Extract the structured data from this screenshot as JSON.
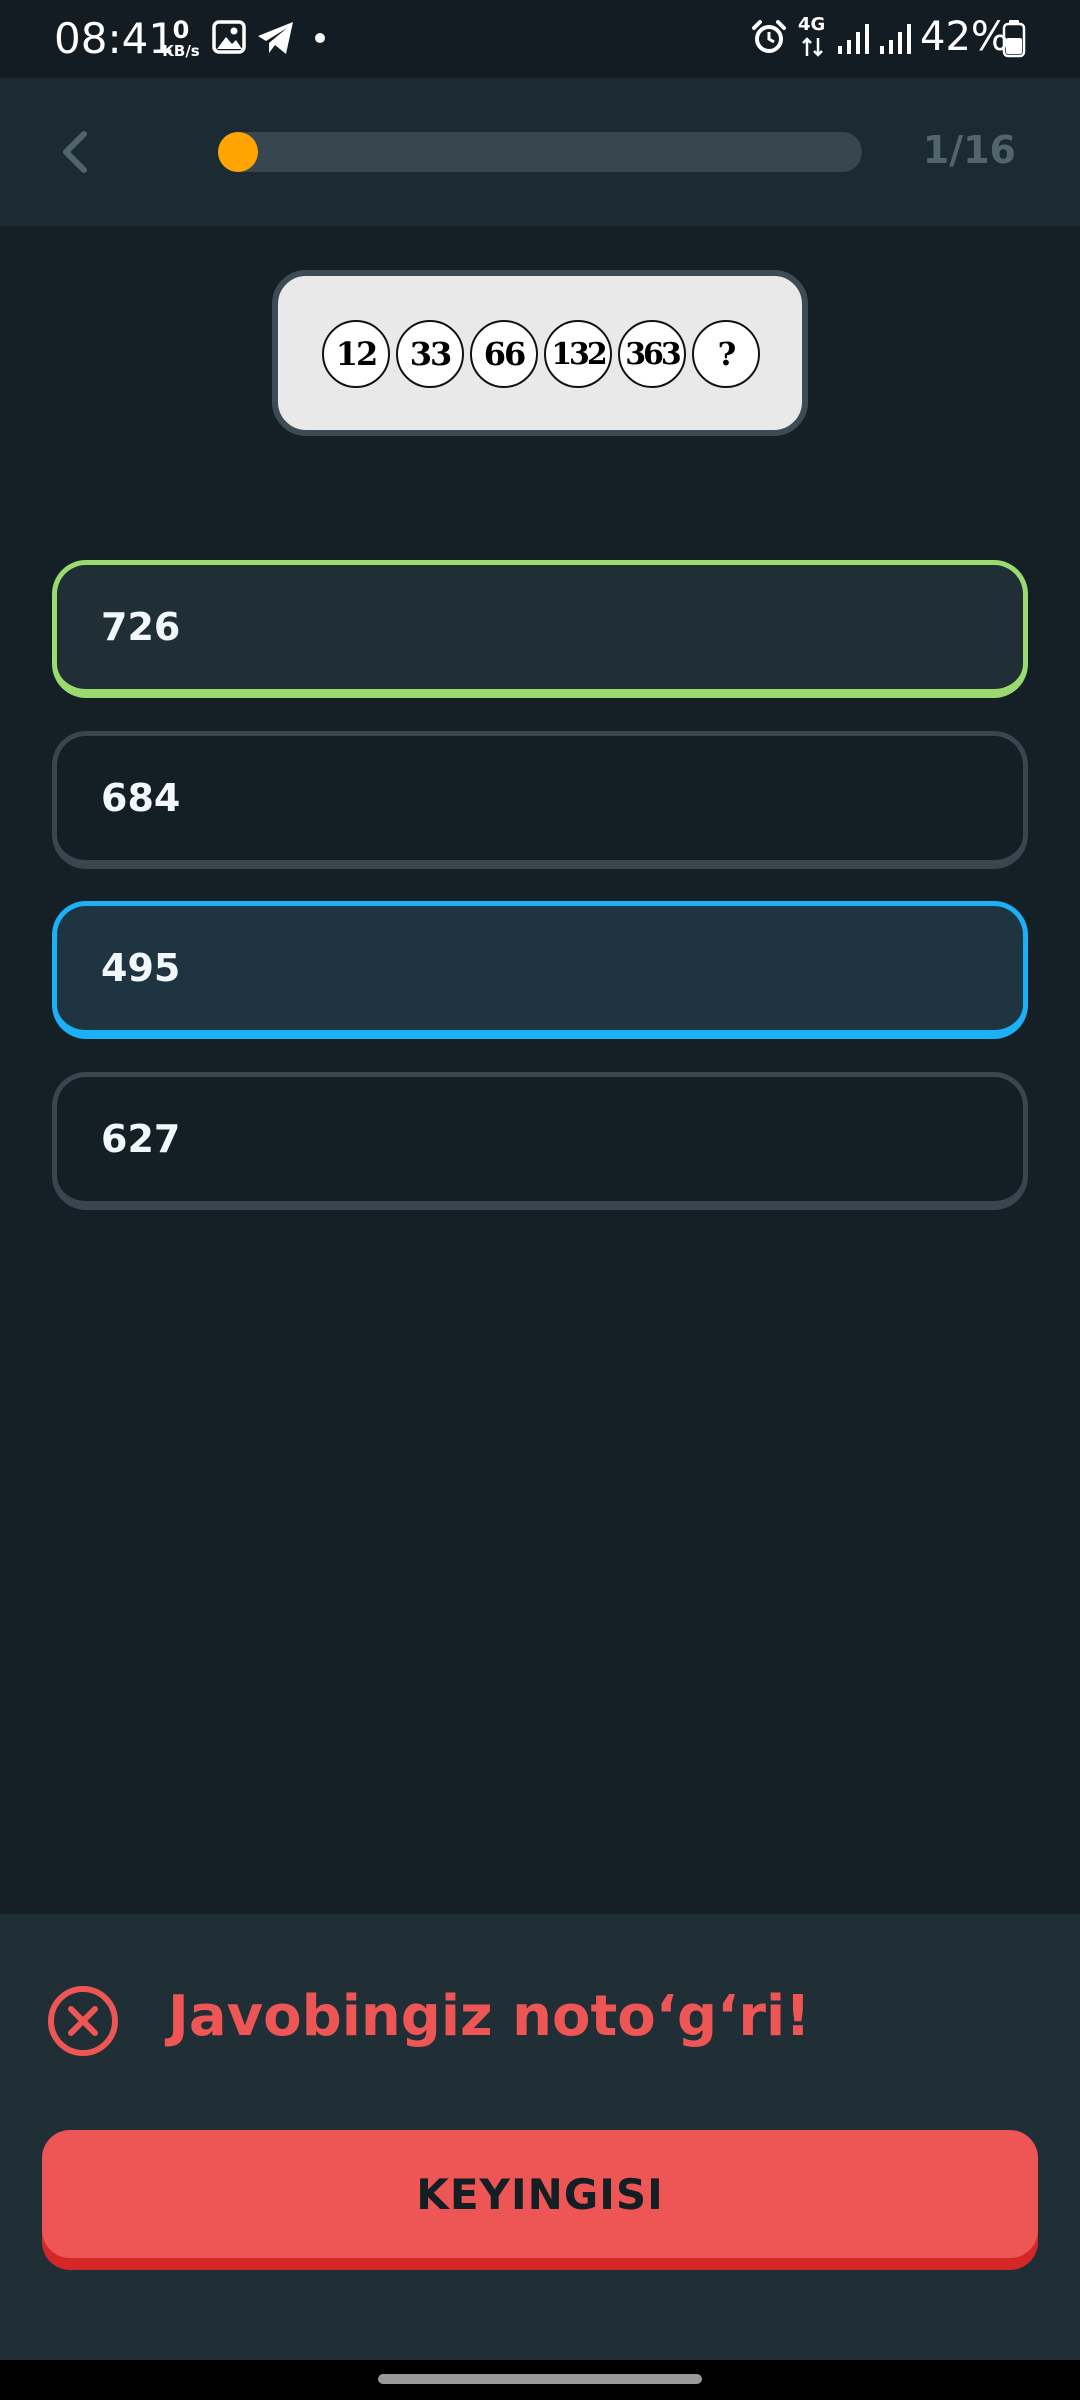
{
  "status_bar": {
    "time": "08:41",
    "net_speed_value": "0",
    "net_speed_unit": "KB/s",
    "network_type": "4G",
    "battery": "42%",
    "icons": [
      "gallery-icon",
      "telegram-icon",
      "dot-icon",
      "alarm-icon",
      "data-arrows-icon",
      "signal-icon",
      "signal-icon",
      "battery-icon"
    ]
  },
  "header": {
    "progress_fraction": 0.03,
    "progress_text": "1/16",
    "accent_color": "#ffa400"
  },
  "question": {
    "sequence": [
      "12",
      "33",
      "66",
      "132",
      "363",
      "?"
    ]
  },
  "options": [
    {
      "label": "726",
      "state": "correct"
    },
    {
      "label": "684",
      "state": "default"
    },
    {
      "label": "495",
      "state": "selected"
    },
    {
      "label": "627",
      "state": "default"
    }
  ],
  "feedback": {
    "message": "Javobingiz noto‘g‘ri!",
    "button_label": "KEYINGISI",
    "color": "#ee5555"
  }
}
